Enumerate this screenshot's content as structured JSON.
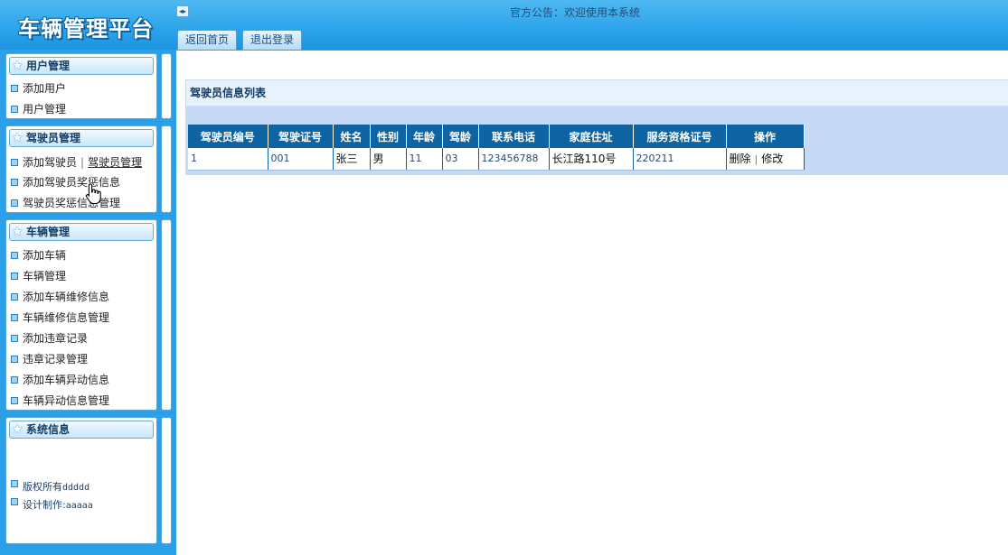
{
  "header": {
    "logo": "车辆管理平台",
    "toggle_icon": "◂▸",
    "notice": "官方公告：欢迎使用本系统",
    "tabs": [
      {
        "label": "返回首页"
      },
      {
        "label": "退出登录"
      }
    ]
  },
  "sidebar": {
    "user_panel": {
      "title": "用户管理",
      "items": [
        "添加用户",
        "用户管理"
      ]
    },
    "driver_panel": {
      "title": "驾驶员管理",
      "items": [
        "添加驾驶员",
        "驾驶员管理",
        "添加驾驶员奖惩信息",
        "驾驶员奖惩信息管理"
      ],
      "separator": "|"
    },
    "vehicle_panel": {
      "title": "车辆管理",
      "items": [
        "添加车辆",
        "车辆管理",
        "添加车辆维修信息",
        "车辆维修信息管理",
        "添加违章记录",
        "违章记录管理",
        "添加车辆异动信息",
        "车辆异动信息管理"
      ]
    },
    "system_panel": {
      "title": "系统信息",
      "copyright_label": "版权所有",
      "copyright_value": "ddddd",
      "design_label": "设计制作:",
      "design_value": "aaaaa"
    }
  },
  "main": {
    "list_title": "驾驶员信息列表",
    "table": {
      "columns": [
        "驾驶员编号",
        "驾驶证号",
        "姓名",
        "性别",
        "年龄",
        "驾龄",
        "联系电话",
        "家庭住址",
        "服务资格证号",
        "操作"
      ],
      "rows": [
        {
          "id": "1",
          "license": "001",
          "name": "张三",
          "gender": "男",
          "age": "11",
          "driving_years": "03",
          "phone": "123456788",
          "address": "长江路110号",
          "cert": "220211",
          "delete": "删除",
          "edit": "修改",
          "action_sep": "|"
        }
      ]
    }
  },
  "colors": {
    "header_blue": "#2ea5ea",
    "table_header": "#0f63a0",
    "sidebar_bg": "#2aa0e8"
  },
  "icons": {
    "panel_icon": "star-icon",
    "item_bullet": "square-bullet-icon",
    "cursor": "hand-pointer-icon"
  }
}
